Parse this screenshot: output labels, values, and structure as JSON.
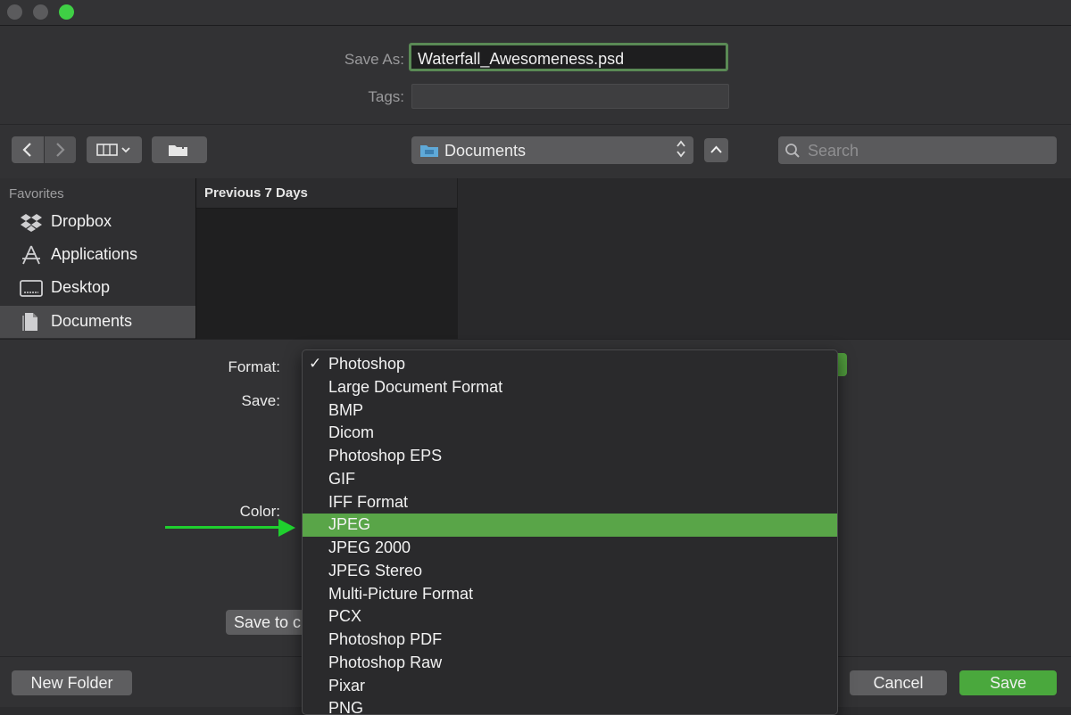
{
  "window": {
    "traffic_lights": [
      "close",
      "minimize",
      "maximize"
    ]
  },
  "save_as": {
    "label": "Save As:",
    "value": "Waterfall_Awesomeness.psd"
  },
  "tags": {
    "label": "Tags:",
    "value": ""
  },
  "toolbar": {
    "back_icon": "chevron-left-icon",
    "forward_icon": "chevron-right-icon",
    "view_icon": "column-view-icon",
    "new_folder_icon": "folder-plus-icon",
    "location": "Documents",
    "location_icon": "folder-icon",
    "search_placeholder": "Search"
  },
  "sidebar": {
    "section_label": "Favorites",
    "items": [
      {
        "label": "Dropbox",
        "icon": "dropbox-icon",
        "selected": false
      },
      {
        "label": "Applications",
        "icon": "applications-icon",
        "selected": false
      },
      {
        "label": "Desktop",
        "icon": "desktop-icon",
        "selected": false
      },
      {
        "label": "Documents",
        "icon": "documents-icon",
        "selected": true
      }
    ]
  },
  "browser": {
    "column_header": "Previous 7 Days"
  },
  "options": {
    "format_label": "Format:",
    "save_label": "Save:",
    "color_label": "Color:",
    "save_to_button": "Save to c"
  },
  "format_menu": {
    "checked": "Photoshop",
    "highlighted": "JPEG",
    "items": [
      "Photoshop",
      "Large Document Format",
      "BMP",
      "Dicom",
      "Photoshop EPS",
      "GIF",
      "IFF Format",
      "JPEG",
      "JPEG 2000",
      "JPEG Stereo",
      "Multi-Picture Format",
      "PCX",
      "Photoshop PDF",
      "Photoshop Raw",
      "Pixar",
      "PNG"
    ]
  },
  "buttons": {
    "new_folder": "New Folder",
    "cancel": "Cancel",
    "save": "Save"
  },
  "colors": {
    "accent_green": "#4aa83d",
    "highlight_green": "#59a548",
    "annotation_arrow": "#1fcf2e"
  }
}
